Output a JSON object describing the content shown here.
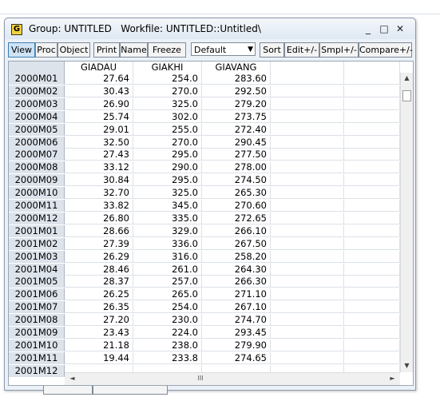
{
  "window": {
    "app_icon_letter": "G",
    "title": "Group: UNTITLED   Workfile: UNTITLED::Untitled\\",
    "minimize_glyph": "_",
    "maximize_glyph": "□",
    "close_glyph": "✕"
  },
  "toolbar": {
    "buttons": [
      "View",
      "Proc",
      "Object",
      "Print",
      "Name",
      "Freeze"
    ],
    "select_value": "Default",
    "buttons_right": [
      "Sort",
      "Edit+/-",
      "Smpl+/-",
      "Compare+/-"
    ]
  },
  "table": {
    "columns": [
      "GIADAU",
      "GIAKHI",
      "GIAVANG"
    ],
    "rows": [
      {
        "label": "2000M01",
        "values": [
          "27.64",
          "254.0",
          "283.60"
        ]
      },
      {
        "label": "2000M02",
        "values": [
          "30.43",
          "270.0",
          "292.50"
        ]
      },
      {
        "label": "2000M03",
        "values": [
          "26.90",
          "325.0",
          "279.20"
        ]
      },
      {
        "label": "2000M04",
        "values": [
          "25.74",
          "302.0",
          "273.75"
        ]
      },
      {
        "label": "2000M05",
        "values": [
          "29.01",
          "255.0",
          "272.40"
        ]
      },
      {
        "label": "2000M06",
        "values": [
          "32.50",
          "270.0",
          "290.45"
        ]
      },
      {
        "label": "2000M07",
        "values": [
          "27.43",
          "295.0",
          "277.50"
        ]
      },
      {
        "label": "2000M08",
        "values": [
          "33.12",
          "290.0",
          "278.00"
        ]
      },
      {
        "label": "2000M09",
        "values": [
          "30.84",
          "295.0",
          "274.50"
        ]
      },
      {
        "label": "2000M10",
        "values": [
          "32.70",
          "325.0",
          "265.30"
        ]
      },
      {
        "label": "2000M11",
        "values": [
          "33.82",
          "345.0",
          "270.60"
        ]
      },
      {
        "label": "2000M12",
        "values": [
          "26.80",
          "335.0",
          "272.65"
        ]
      },
      {
        "label": "2001M01",
        "values": [
          "28.66",
          "329.0",
          "266.10"
        ]
      },
      {
        "label": "2001M02",
        "values": [
          "27.39",
          "336.0",
          "267.50"
        ]
      },
      {
        "label": "2001M03",
        "values": [
          "26.29",
          "316.0",
          "258.20"
        ]
      },
      {
        "label": "2001M04",
        "values": [
          "28.46",
          "261.0",
          "264.30"
        ]
      },
      {
        "label": "2001M05",
        "values": [
          "28.37",
          "257.0",
          "266.30"
        ]
      },
      {
        "label": "2001M06",
        "values": [
          "26.25",
          "265.0",
          "271.10"
        ]
      },
      {
        "label": "2001M07",
        "values": [
          "26.35",
          "254.0",
          "267.10"
        ]
      },
      {
        "label": "2001M08",
        "values": [
          "27.20",
          "230.0",
          "274.70"
        ]
      },
      {
        "label": "2001M09",
        "values": [
          "23.43",
          "224.0",
          "293.45"
        ]
      },
      {
        "label": "2001M10",
        "values": [
          "21.18",
          "238.0",
          "279.90"
        ]
      },
      {
        "label": "2001M11",
        "values": [
          "19.44",
          "233.8",
          "274.65"
        ]
      },
      {
        "label": "2001M12",
        "values": [
          "",
          "",
          ""
        ]
      }
    ]
  },
  "scrollbars": {
    "up_arrow": "▲",
    "down_arrow": "▼",
    "left_arrow": "◄",
    "right_arrow": "►",
    "grip": "III"
  }
}
